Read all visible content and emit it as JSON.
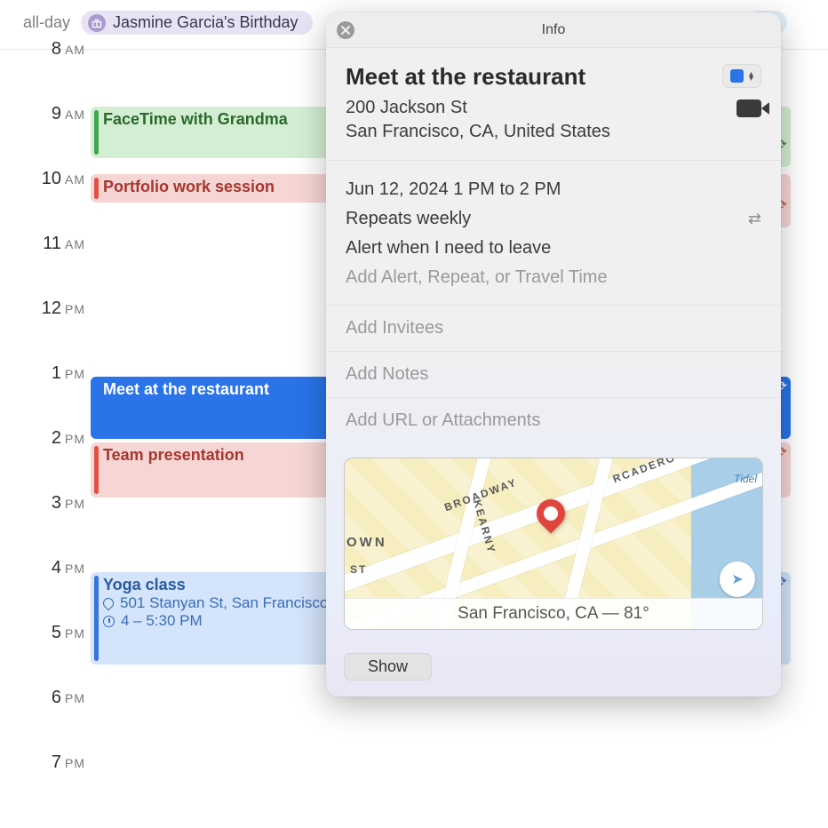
{
  "allday": {
    "label": "all-day",
    "event": "Jasmine Garcia's Birthday"
  },
  "hours": [
    "8",
    "9",
    "10",
    "11",
    "12",
    "1",
    "2",
    "3",
    "4",
    "5",
    "6",
    "7"
  ],
  "ampm": [
    "AM",
    "AM",
    "AM",
    "AM",
    "PM",
    "PM",
    "PM",
    "PM",
    "PM",
    "PM",
    "PM",
    "PM"
  ],
  "events": {
    "facetime": "FaceTime with Grandma",
    "portfolio": "Portfolio work session",
    "meet": "Meet at the restaurant",
    "team": "Team presentation",
    "yoga_title": "Yoga class",
    "yoga_loc": "501 Stanyan St, San Francisco",
    "yoga_time": "4 – 5:30 PM"
  },
  "popover": {
    "header": "Info",
    "title": "Meet at the restaurant",
    "addr1": "200 Jackson St",
    "addr2": "San Francisco, CA, United States",
    "when": "Jun 12, 2024  1 PM to 2 PM",
    "repeat": "Repeats weekly",
    "alert": "Alert when I need to leave",
    "add_art": "Add Alert, Repeat, or Travel Time",
    "add_invitees": "Add Invitees",
    "add_notes": "Add Notes",
    "add_url": "Add URL or Attachments",
    "map_weather": "San Francisco, CA — 81°",
    "roads": {
      "broadway": "BROADWAY",
      "kearny": "KEARNY",
      "own": "OWN",
      "st": "ST",
      "embarcadero": "RCADERO",
      "tidel": "Tidel"
    },
    "show": "Show",
    "calendar_color": "#2a73e8"
  }
}
